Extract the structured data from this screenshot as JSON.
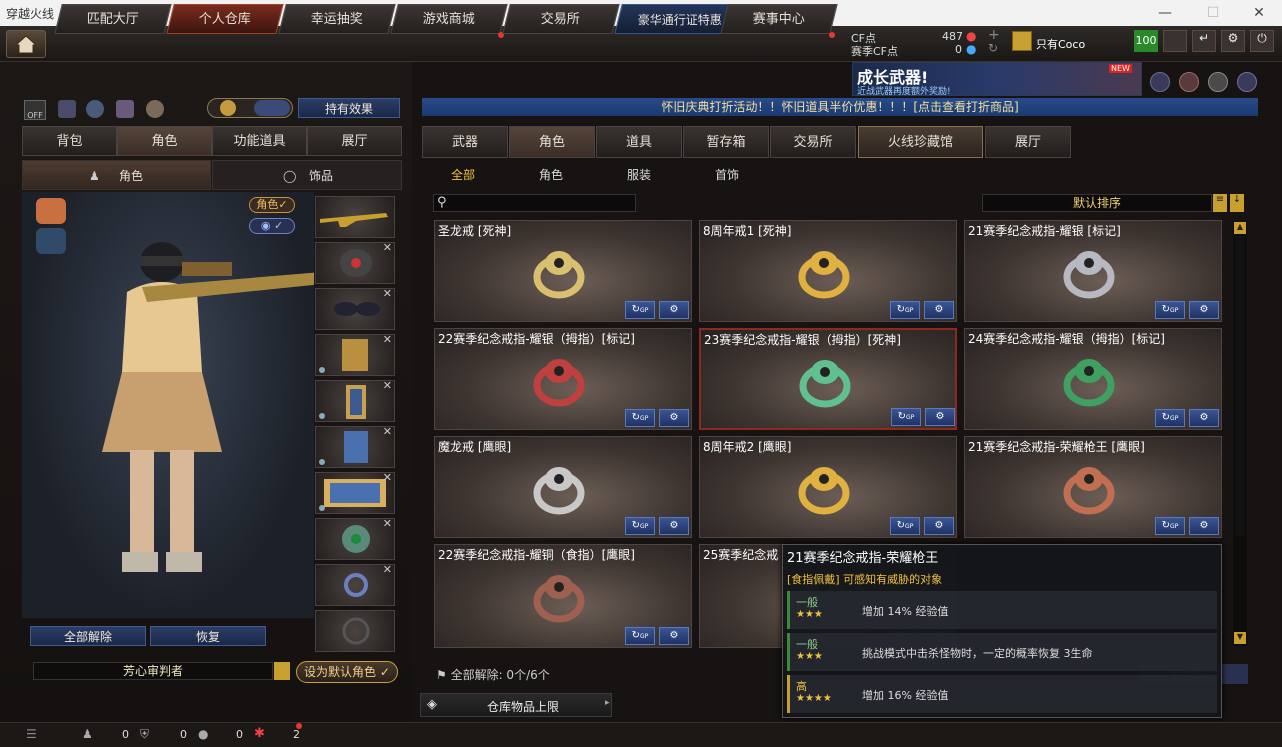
{
  "window": {
    "title": "穿越火线",
    "min": "—",
    "max": "☐",
    "close": "✕"
  },
  "nav": {
    "tabs": [
      "匹配大厅",
      "个人仓库",
      "幸运抽奖",
      "游戏商城",
      "交易所",
      "豪华通行证特惠",
      "赛事中心"
    ],
    "cf_label": "CF点",
    "cf_value": "487",
    "season_label": "赛季CF点",
    "season_value": "0",
    "username": "只有Coco",
    "level": "100"
  },
  "banner": {
    "text": "成长武器!",
    "sub": "近战武器再度额外奖励!",
    "new": "NEW"
  },
  "left": {
    "toggle_off": "OFF",
    "effects_button": "持有效果",
    "tabs": [
      "背包",
      "角色",
      "功能道具",
      "展厅"
    ],
    "subtabs": [
      "角色",
      "饰品"
    ],
    "char_badge": "角色",
    "unequip_all": "全部解除",
    "restore": "恢复",
    "char_name": "芳心审判者",
    "set_default": "设为默认角色"
  },
  "right": {
    "notice": "怀旧庆典打折活动！！怀旧道具半价优惠！！！[点击查看打折商品]",
    "tabs": [
      "武器",
      "角色",
      "道具",
      "暂存箱",
      "交易所",
      "火线珍藏馆",
      "展厅"
    ],
    "filters": [
      "全部",
      "角色",
      "服装",
      "首饰"
    ],
    "sort": "默认排序",
    "items": [
      {
        "name": "圣龙戒 [死神]",
        "color": "#d8c070"
      },
      {
        "name": "8周年戒1 [死神]",
        "color": "#e0b040"
      },
      {
        "name": "21赛季纪念戒指-耀银 [标记]",
        "color": "#b8b8c0"
      },
      {
        "name": "22赛季纪念戒指-耀银（拇指）[标记]",
        "color": "#c04040"
      },
      {
        "name": "23赛季纪念戒指-耀银（拇指）[死神]",
        "color": "#60c090"
      },
      {
        "name": "24赛季纪念戒指-耀银（拇指）[标记]",
        "color": "#40a060"
      },
      {
        "name": "魔龙戒 [鹰眼]",
        "color": "#c8c8c8"
      },
      {
        "name": "8周年戒2 [鹰眼]",
        "color": "#e0b040"
      },
      {
        "name": "21赛季纪念戒指-荣耀枪王 [鹰眼]",
        "color": "#c07050"
      },
      {
        "name": "22赛季纪念戒指-耀铜（食指）[鹰眼]",
        "color": "#a06050"
      },
      {
        "name": "25赛季纪念戒",
        "color": "#888"
      }
    ],
    "unequip_info": "全部解除: 0个/6个",
    "storage_limit": "仓库物品上限",
    "btn_gp": "GP",
    "all_unequip_right": "全部解除"
  },
  "tooltip": {
    "title": "21赛季纪念戒指-荣耀枪王",
    "subtitle": "[食指佩戴] 可感知有威胁的对象",
    "lines": [
      {
        "grade": "一般",
        "stars": "★★★",
        "text": "增加 14% 经验值"
      },
      {
        "grade": "一般",
        "stars": "★★★",
        "text": "挑战模式中击杀怪物时，一定的概率恢复 3生命"
      },
      {
        "grade": "高",
        "stars": "★★★★",
        "text": "增加 16% 经验值"
      }
    ]
  },
  "bottom": {
    "count1": "0",
    "count2": "0",
    "count3": "0",
    "count4": "2"
  }
}
